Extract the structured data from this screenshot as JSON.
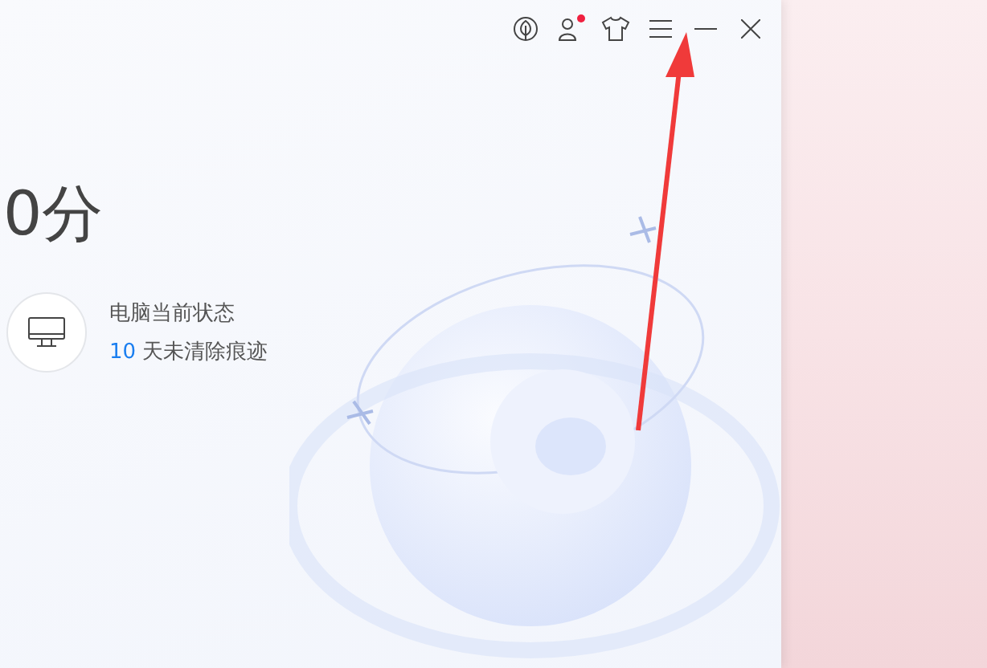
{
  "title_bar": {
    "has_notification": true
  },
  "score": {
    "text": "0分"
  },
  "status": {
    "title": "电脑当前状态",
    "days": "10",
    "text": "天未清除痕迹"
  }
}
